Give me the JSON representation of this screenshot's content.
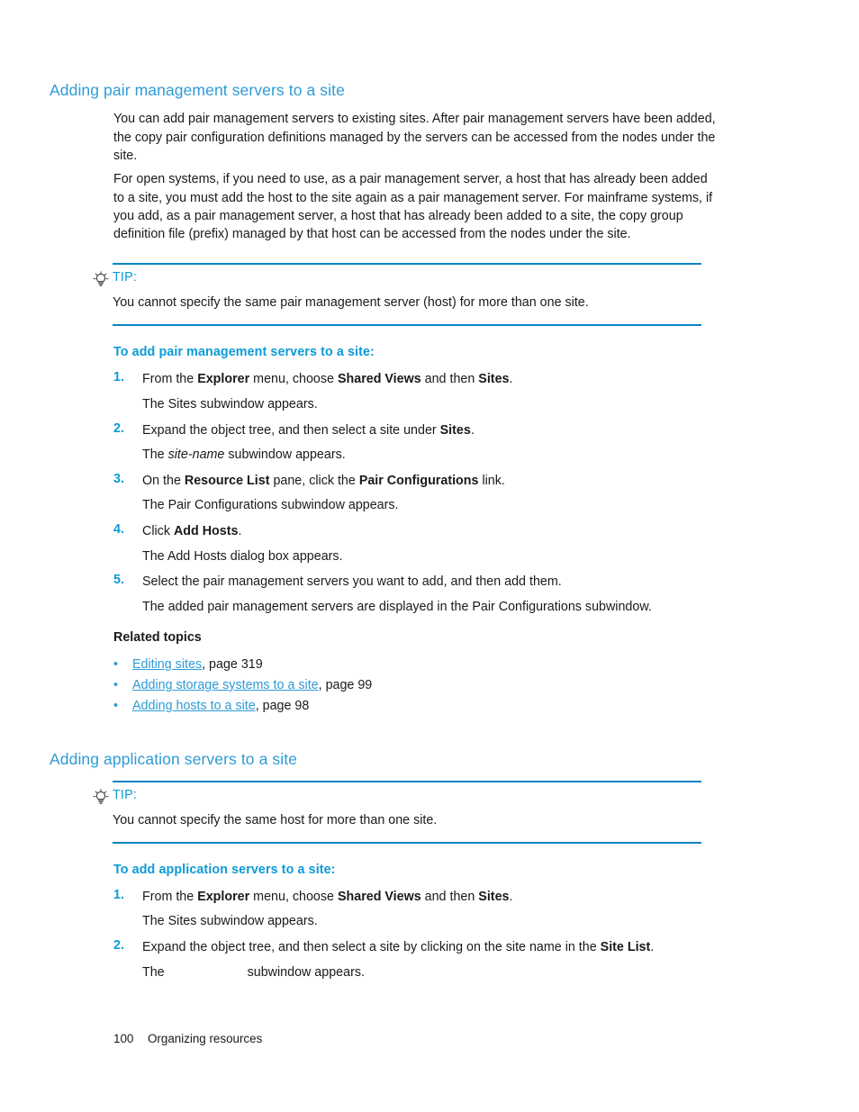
{
  "page": {
    "footer_page_number": "100",
    "footer_chapter": "Organizing resources"
  },
  "colors": {
    "heading_blue": "#2e9bd6",
    "procedure_blue": "#0c9ad7",
    "rule_blue": "#0c82c4",
    "body_black": "#1a1a1a"
  },
  "section1": {
    "heading": "Adding pair management servers to a site",
    "paragraph1": "You can add pair management servers to existing sites. After pair management servers have been added, the copy pair configuration definitions managed by the servers can be accessed from the nodes under the site.",
    "paragraph2": "For open systems, if you need to use, as a pair management server, a host that has already been added to a site, you must add the host to the site again as a pair management server. For mainframe systems, if you add, as a pair management server, a host that has already been added to a site, the copy group definition file (prefix) managed by that host can be accessed from the nodes under the site.",
    "tip": {
      "icon": "lightbulb-tip-icon",
      "label": "TIP:",
      "text": "You cannot specify the same pair management server (host) for more than one site."
    },
    "procedure": {
      "title": "To add pair management servers to a site:",
      "steps": [
        {
          "number": "1.",
          "text_parts": [
            {
              "t": "From the ",
              "style": "normal"
            },
            {
              "t": "Explorer",
              "style": "bold"
            },
            {
              "t": " menu, choose ",
              "style": "normal"
            },
            {
              "t": "Shared Views",
              "style": "bold"
            },
            {
              "t": " and then ",
              "style": "normal"
            },
            {
              "t": "Sites",
              "style": "bold"
            },
            {
              "t": ".",
              "style": "normal"
            }
          ],
          "result_parts": [
            {
              "t": "The Sites subwindow appears.",
              "style": "normal"
            }
          ]
        },
        {
          "number": "2.",
          "text_parts": [
            {
              "t": "Expand the object tree, and then select a site under ",
              "style": "normal"
            },
            {
              "t": "Sites",
              "style": "bold"
            },
            {
              "t": ".",
              "style": "normal"
            }
          ],
          "result_parts": [
            {
              "t": "The ",
              "style": "normal"
            },
            {
              "t": "site-name",
              "style": "italic"
            },
            {
              "t": " subwindow appears.",
              "style": "normal"
            }
          ]
        },
        {
          "number": "3.",
          "text_parts": [
            {
              "t": "On the ",
              "style": "normal"
            },
            {
              "t": "Resource List",
              "style": "bold"
            },
            {
              "t": " pane, click the ",
              "style": "normal"
            },
            {
              "t": "Pair Configurations",
              "style": "bold"
            },
            {
              "t": " link.",
              "style": "normal"
            }
          ],
          "result_parts": [
            {
              "t": "The Pair Configurations subwindow appears.",
              "style": "normal"
            }
          ]
        },
        {
          "number": "4.",
          "text_parts": [
            {
              "t": "Click ",
              "style": "normal"
            },
            {
              "t": "Add Hosts",
              "style": "bold"
            },
            {
              "t": ".",
              "style": "normal"
            }
          ],
          "result_parts": [
            {
              "t": "The Add Hosts dialog box appears.",
              "style": "normal"
            }
          ]
        },
        {
          "number": "5.",
          "text_parts": [
            {
              "t": "Select the pair management servers you want to add, and then add them.",
              "style": "normal"
            }
          ],
          "result_parts": [
            {
              "t": "The added pair management servers are displayed in the Pair Configurations subwindow.",
              "style": "normal"
            }
          ]
        }
      ]
    },
    "related_topics": {
      "heading": "Related topics",
      "items": [
        {
          "link": "Editing sites",
          "page_ref": ", page 319"
        },
        {
          "link": "Adding storage systems to a site",
          "page_ref": ", page 99"
        },
        {
          "link": "Adding hosts to a site",
          "page_ref": ", page 98"
        }
      ]
    }
  },
  "section2": {
    "heading": "Adding application servers to a site",
    "tip": {
      "icon": "lightbulb-tip-icon",
      "label": "TIP:",
      "text": "You cannot specify the same host for more than one site."
    },
    "procedure": {
      "title": "To add application servers to a site:",
      "steps": [
        {
          "number": "1.",
          "text_parts": [
            {
              "t": "From the ",
              "style": "normal"
            },
            {
              "t": "Explorer",
              "style": "bold"
            },
            {
              "t": " menu, choose ",
              "style": "normal"
            },
            {
              "t": "Shared Views",
              "style": "bold"
            },
            {
              "t": " and then ",
              "style": "normal"
            },
            {
              "t": "Sites",
              "style": "bold"
            },
            {
              "t": ".",
              "style": "normal"
            }
          ],
          "result_parts": [
            {
              "t": "The Sites subwindow appears.",
              "style": "normal"
            }
          ]
        },
        {
          "number": "2.",
          "text_parts": [
            {
              "t": "Expand the object tree, and then select a site by clicking on the site name in the ",
              "style": "normal"
            },
            {
              "t": "Site List",
              "style": "bold"
            },
            {
              "t": ".",
              "style": "normal"
            }
          ],
          "result_parts": [
            {
              "t": "The ",
              "style": "normal"
            },
            {
              "t": "",
              "style": "gap"
            },
            {
              "t": "subwindow appears.",
              "style": "normal"
            }
          ]
        }
      ]
    }
  }
}
